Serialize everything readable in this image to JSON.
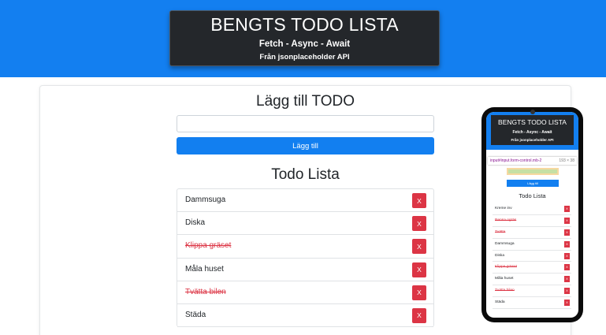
{
  "header": {
    "title": "BENGTS TODO LISTA",
    "subtitle": "Fetch - Async - Await",
    "source": "Från jsonplaceholder API"
  },
  "add": {
    "heading": "Lägg till TODO",
    "input_value": "",
    "button_label": "Lägg till"
  },
  "list": {
    "heading": "Todo Lista",
    "delete_label": "X",
    "items": [
      {
        "label": "Dammsuga",
        "done": false
      },
      {
        "label": "Diska",
        "done": false
      },
      {
        "label": "Klippa gräset",
        "done": true
      },
      {
        "label": "Måla huset",
        "done": false
      },
      {
        "label": "Tvätta bilen",
        "done": true
      },
      {
        "label": "Städa",
        "done": false
      }
    ]
  },
  "phone": {
    "title": "BENGTS TODO LISTA",
    "subtitle": "Fetch - Async - Await",
    "source": "Från jsonplaceholder API",
    "tooltip_selector": "input#input.form-control.mb-2",
    "tooltip_size": "193 × 38",
    "button_label": "Lägg till",
    "heading": "Todo Lista",
    "delete_label": "X",
    "items": [
      {
        "label": "Kreme inv",
        "done": false
      },
      {
        "label": "Rensa ogräs",
        "done": true
      },
      {
        "label": "Tvätta",
        "done": true
      },
      {
        "label": "Dammsuga",
        "done": false
      },
      {
        "label": "Diska",
        "done": false
      },
      {
        "label": "Klippa gräset",
        "done": true
      },
      {
        "label": "Måla huset",
        "done": false
      },
      {
        "label": "Tvätta bilen",
        "done": true
      },
      {
        "label": "Städa",
        "done": false
      }
    ]
  },
  "colors": {
    "brand_blue": "#137ff0",
    "header_dark": "#24272b",
    "danger": "#dc3545"
  }
}
